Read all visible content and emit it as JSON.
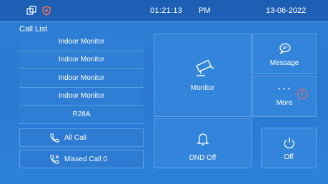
{
  "status": {
    "time": "01:21:13",
    "ampm": "PM",
    "date": "13-06-2022",
    "icons": [
      "windows-icon",
      "shield-icon"
    ]
  },
  "call_list": {
    "title": "Call List",
    "items": [
      {
        "label": "Indoor Monitor"
      },
      {
        "label": "Indoor Monitor"
      },
      {
        "label": "Indoor Monitor"
      },
      {
        "label": "Indoor Monitor"
      },
      {
        "label": "R28A"
      }
    ],
    "all_call_label": "All Call",
    "missed_call_label": "Missed Call 0"
  },
  "tiles": {
    "monitor_label": "Monitor",
    "message_label": "Message",
    "more_label": "More",
    "more_dots": "• • •",
    "more_badge": "!",
    "dnd_label": "DND Off",
    "off_label": "Off"
  },
  "colors": {
    "background": "#2c7cd5",
    "statusbar": "#1d5fb4",
    "badge": "#ff6a4d"
  }
}
